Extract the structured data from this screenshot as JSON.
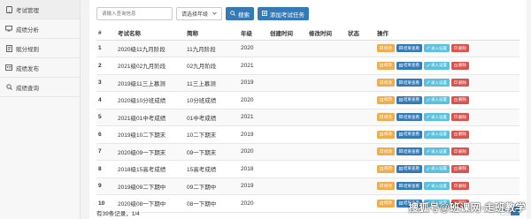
{
  "sidebar": {
    "items": [
      {
        "label": "考试管理",
        "icon": "tablet-icon"
      },
      {
        "label": "成绩分析",
        "icon": "monitor-icon"
      },
      {
        "label": "赋分规则",
        "icon": "doc-icon"
      },
      {
        "label": "成绩发布",
        "icon": "id-card-icon"
      },
      {
        "label": "成绩查询",
        "icon": "search-icon"
      }
    ]
  },
  "toolbar": {
    "search_placeholder": "请输入查询信息",
    "grade_select": "请选择年级",
    "search_button": "搜索",
    "add_button": "添加考试任务"
  },
  "table": {
    "columns": [
      "#",
      "考试名称",
      "简称",
      "年级",
      "创建时间",
      "修改时间",
      "状态",
      "操作"
    ],
    "rows": [
      {
        "idx": "1",
        "name": "2020级11九月阶段",
        "short": "11九月阶段",
        "grade": "2020"
      },
      {
        "idx": "2",
        "name": "2021级02九月阶段",
        "short": "02九月阶段",
        "grade": "2021"
      },
      {
        "idx": "3",
        "name": "2019级11三上慕测",
        "short": "11三上慕测",
        "grade": "2019"
      },
      {
        "idx": "4",
        "name": "2020级10分班成绩",
        "short": "10分班成绩",
        "grade": "2020"
      },
      {
        "idx": "5",
        "name": "2021级01中考成绩",
        "short": "01中考成绩",
        "grade": "2021"
      },
      {
        "idx": "6",
        "name": "2019级10二下期末",
        "short": "10二下期末",
        "grade": "2019"
      },
      {
        "idx": "7",
        "name": "2020级09一下期末",
        "short": "09一下期末",
        "grade": "2020"
      },
      {
        "idx": "8",
        "name": "2018级15高考成绩",
        "short": "15高考成绩",
        "grade": "2018"
      },
      {
        "idx": "9",
        "name": "2019级09二下期中",
        "short": "09二下期中",
        "grade": "2019"
      },
      {
        "idx": "10",
        "name": "2020级08一下期中",
        "short": "08一下期中",
        "grade": "2020"
      }
    ],
    "actions": {
      "edit": "修改",
      "view": "结果查看",
      "set": "录入设置",
      "delete": "删除"
    }
  },
  "footer": {
    "summary": "有39条记录，1/4",
    "pages": [
      "⏮",
      "1"
    ]
  },
  "watermark": "搜狐号@班课网-走班教学",
  "colors": {
    "primary": "#337ab7",
    "warning": "#f0ad4e",
    "info": "#5bc0de",
    "danger": "#d9534f"
  }
}
